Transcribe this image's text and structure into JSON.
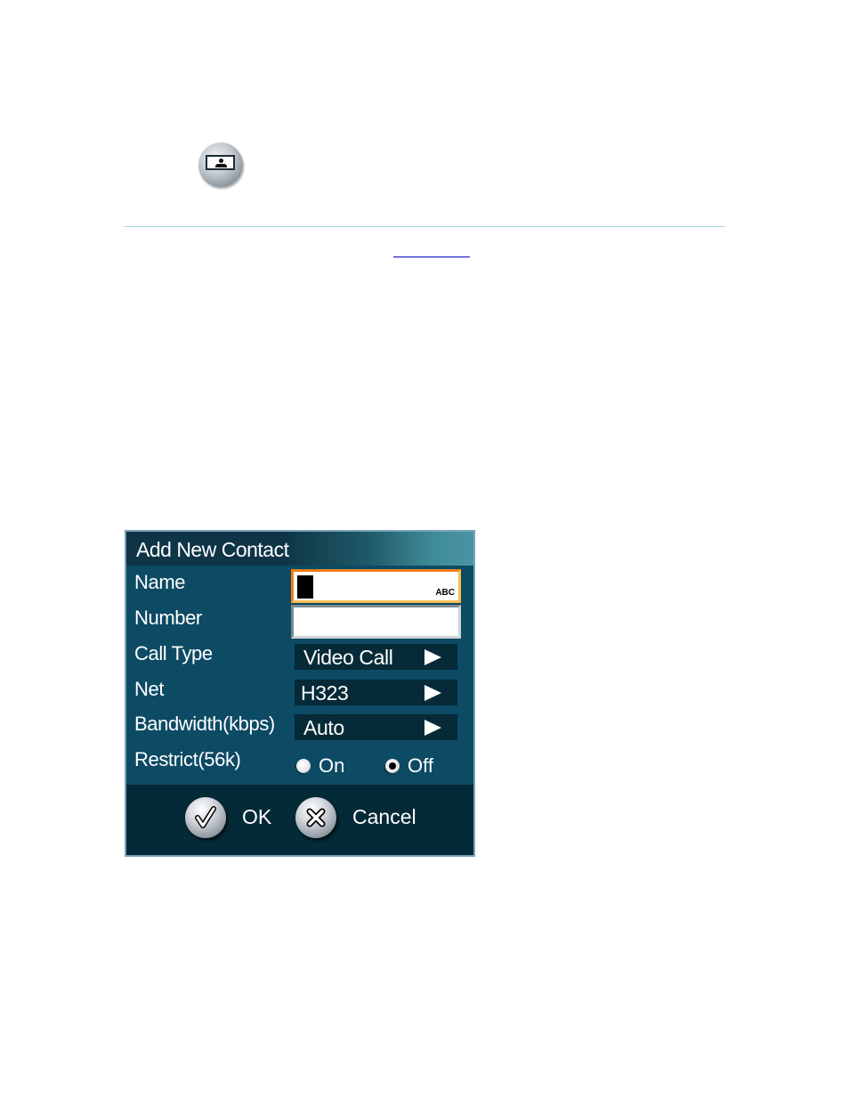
{
  "page": {
    "icon": "contact-card-icon"
  },
  "dialog": {
    "title": "Add New Contact",
    "fields": {
      "name": {
        "label": "Name",
        "value": "",
        "input_mode": "ABC"
      },
      "number": {
        "label": "Number",
        "value": ""
      },
      "call_type": {
        "label": "Call Type",
        "value": "Video Call"
      },
      "net": {
        "label": "Net",
        "value": "H323"
      },
      "bandwidth": {
        "label": "Bandwidth(kbps)",
        "value": "Auto"
      },
      "restrict": {
        "label": "Restrict(56k)",
        "options": [
          "On",
          "Off"
        ],
        "selected": "Off"
      }
    },
    "buttons": {
      "ok": "OK",
      "cancel": "Cancel"
    }
  },
  "colors": {
    "dialog_bg": "#0d4a64",
    "footer_bg": "#052a37",
    "focus_border": "#f47f15",
    "link": "#0000cc",
    "divider": "#a9d6df"
  }
}
